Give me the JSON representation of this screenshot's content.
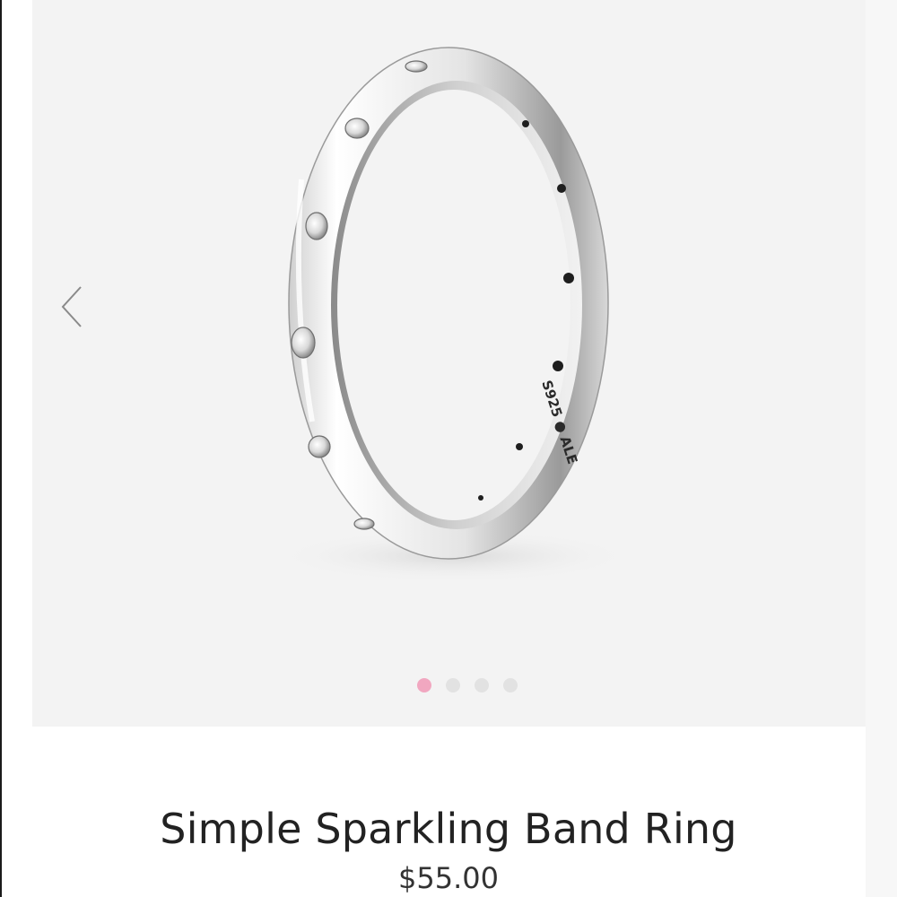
{
  "product": {
    "title": "Simple Sparkling Band Ring",
    "price": "$55.00",
    "engraving": "S925 ● ALE"
  },
  "gallery": {
    "prev_icon": "chevron-left-icon",
    "next_icon": "chevron-right-icon",
    "slide_count": 4,
    "active_slide": 1,
    "active_dot_color": "#f1a7c0",
    "inactive_dot_color": "#e2e2e2"
  }
}
